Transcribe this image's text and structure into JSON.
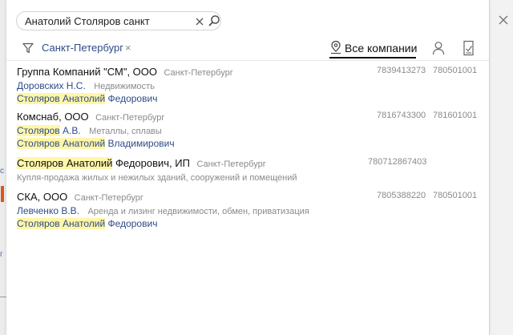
{
  "search": {
    "value": "Анатолий Столяров санкт",
    "placeholder": ""
  },
  "filter": {
    "city": "Санкт-Петербург",
    "remove": "×"
  },
  "tabs": {
    "all_companies": "Все компании"
  },
  "results": [
    {
      "name": "Группа Компаний \"СМ\", ООО",
      "city": "Санкт-Петербург",
      "inn": "7839413273",
      "kpp": "780501001",
      "person": "Доровских Н.С.",
      "activity": "Недвижимость",
      "director_hl": "Столяров Анатолий",
      "director_rest": " Федорович"
    },
    {
      "name": "Комснаб, ООО",
      "city": "Санкт-Петербург",
      "inn": "7816743300",
      "kpp": "781601001",
      "person_hl": "Столяров",
      "person_rest": " А.В.",
      "activity": "Металлы, сплавы",
      "director_hl": "Столяров Анатолий",
      "director_rest": " Владимирович"
    },
    {
      "name_hl": "Столяров Анатолий",
      "name_rest": " Федорович, ИП",
      "city": "Санкт-Петербург",
      "inn": "780712867403",
      "activity": "Купля-продажа жилых и нежилых зданий, сооружений и помещений"
    },
    {
      "name": "СКА, ООО",
      "city": "Санкт-Петербург",
      "inn": "7805388220",
      "kpp": "780501001",
      "person": "Левченко В.В.",
      "activity": "Аренда и лизинг недвижимости, обмен, приватизация",
      "director_hl": "Столяров Анатолий",
      "director_rest": " Федорович"
    }
  ],
  "background": {
    "char1": "с",
    "char2": "г"
  },
  "colors": {
    "highlight": "#fff6a8",
    "link": "#2e4c86",
    "accent": "#d8561f"
  }
}
